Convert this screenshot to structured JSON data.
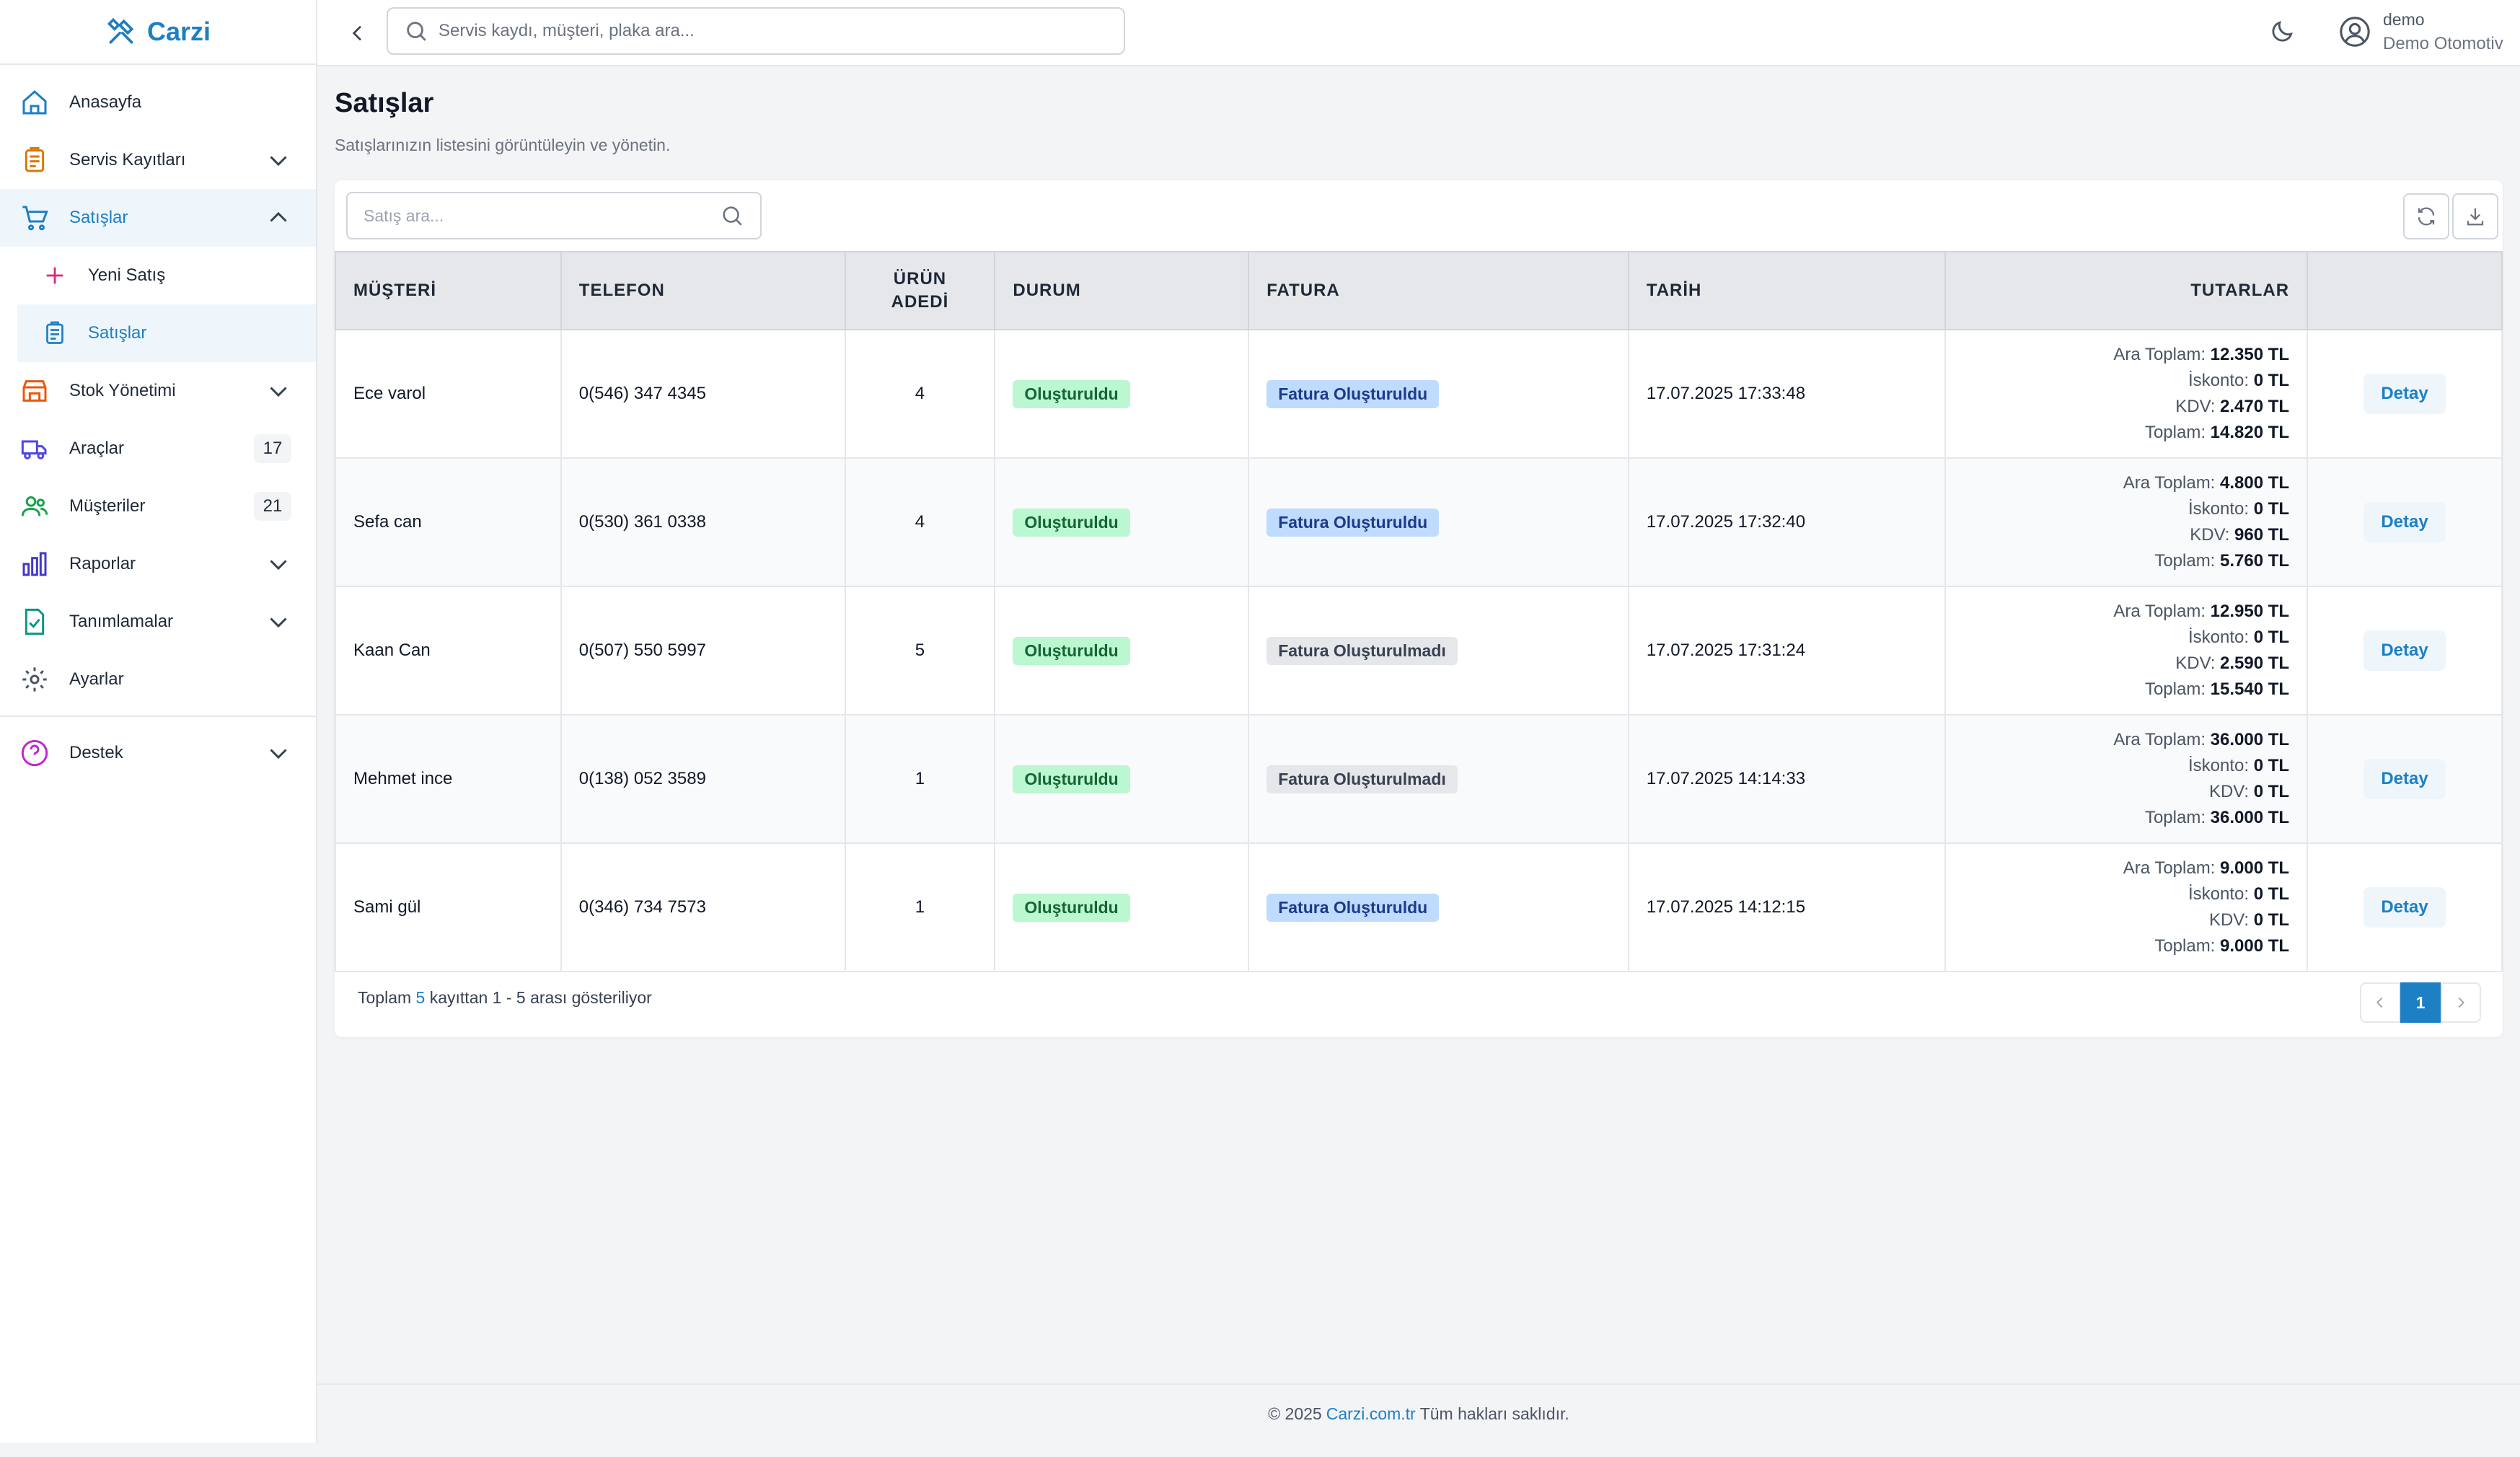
{
  "app": {
    "name": "Carzi"
  },
  "sidebar": {
    "items": [
      {
        "label": "Anasayfa"
      },
      {
        "label": "Servis Kayıtları"
      },
      {
        "label": "Satışlar"
      },
      {
        "label": "Yeni Satış"
      },
      {
        "label": "Satışlar"
      },
      {
        "label": "Stok Yönetimi"
      },
      {
        "label": "Araçlar",
        "badge": "17"
      },
      {
        "label": "Müşteriler",
        "badge": "21"
      },
      {
        "label": "Raporlar"
      },
      {
        "label": "Tanımlamalar"
      },
      {
        "label": "Ayarlar"
      },
      {
        "label": "Destek"
      }
    ],
    "icons": [
      "home-icon",
      "clipboard-icon",
      "cart-icon",
      "plus-icon",
      "clipboard-icon",
      "store-icon",
      "truck-icon",
      "users-icon",
      "bar-chart-icon",
      "file-check-icon",
      "gear-icon",
      "help-circle-icon"
    ]
  },
  "topbar": {
    "search_placeholder": "Servis kaydı, müşteri, plaka ara...",
    "username": "demo",
    "company": "Demo Otomotiv"
  },
  "page": {
    "title": "Satışlar",
    "subtitle": "Satışlarınızın listesini görüntüleyin ve yönetin."
  },
  "table": {
    "search_placeholder": "Satış ara...",
    "columns": {
      "customer": "MÜŞTERİ",
      "phone": "TELEFON",
      "qty_line1": "ÜRÜN",
      "qty_line2": "ADEDİ",
      "status": "DURUM",
      "invoice": "FATURA",
      "date": "TARİH",
      "totals": "TUTARLAR"
    },
    "total_labels": {
      "subtotal": "Ara Toplam:",
      "discount": "İskonto:",
      "vat": "KDV:",
      "total": "Toplam:"
    },
    "rows": [
      {
        "customer": "Ece varol",
        "phone": "0(546) 347 4345",
        "qty": "4",
        "status": "Oluşturuldu",
        "invoice": "Fatura Oluşturuldu",
        "date": "17.07.2025 17:33:48",
        "subtotal": "12.350 TL",
        "discount": "0 TL",
        "vat": "2.470 TL",
        "total": "14.820 TL",
        "action": "Detay"
      },
      {
        "customer": "Sefa can",
        "phone": "0(530) 361 0338",
        "qty": "4",
        "status": "Oluşturuldu",
        "invoice": "Fatura Oluşturuldu",
        "date": "17.07.2025 17:32:40",
        "subtotal": "4.800 TL",
        "discount": "0 TL",
        "vat": "960 TL",
        "total": "5.760 TL",
        "action": "Detay"
      },
      {
        "customer": "Kaan Can",
        "phone": "0(507) 550 5997",
        "qty": "5",
        "status": "Oluşturuldu",
        "invoice": "Fatura Oluşturulmadı",
        "date": "17.07.2025 17:31:24",
        "subtotal": "12.950 TL",
        "discount": "0 TL",
        "vat": "2.590 TL",
        "total": "15.540 TL",
        "action": "Detay"
      },
      {
        "customer": "Mehmet ince",
        "phone": "0(138) 052 3589",
        "qty": "1",
        "status": "Oluşturuldu",
        "invoice": "Fatura Oluşturulmadı",
        "date": "17.07.2025 14:14:33",
        "subtotal": "36.000 TL",
        "discount": "0 TL",
        "vat": "0 TL",
        "total": "36.000 TL",
        "action": "Detay"
      },
      {
        "customer": "Sami gül",
        "phone": "0(346) 734 7573",
        "qty": "1",
        "status": "Oluşturuldu",
        "invoice": "Fatura Oluşturuldu",
        "date": "17.07.2025 14:12:15",
        "subtotal": "9.000 TL",
        "discount": "0 TL",
        "vat": "0 TL",
        "total": "9.000 TL",
        "action": "Detay"
      }
    ],
    "summary": {
      "prefix": "Toplam",
      "count": "5",
      "suffix": "kayıttan 1 - 5 arası gösteriliyor"
    },
    "pagination": {
      "current": "1"
    }
  },
  "footer": {
    "prefix": "© 2025",
    "link": "Carzi.com.tr",
    "suffix": "Tüm hakları saklıdır."
  },
  "colors": {
    "accent": "#1d7fc4",
    "status_green": "#bbf7d0",
    "invoice_blue": "#bfdbfe",
    "invoice_gray": "#e5e7eb"
  }
}
